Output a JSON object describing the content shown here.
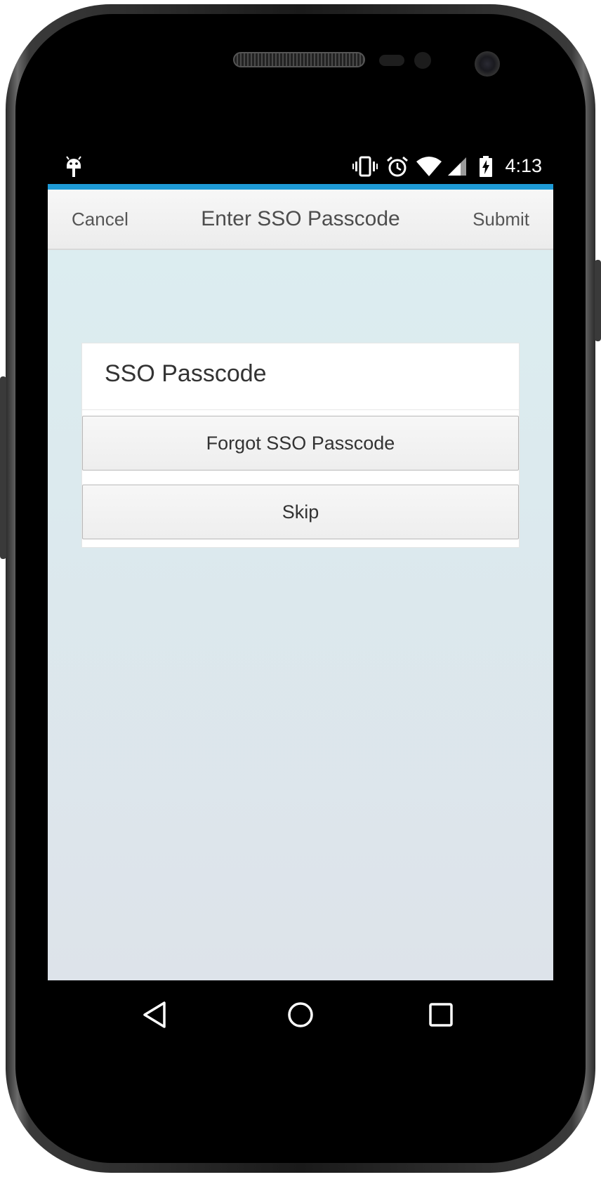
{
  "status_bar": {
    "time": "4:13",
    "icons": [
      "android-icon",
      "vibrate-icon",
      "alarm-icon",
      "wifi-icon",
      "signal-icon",
      "battery-charging-icon"
    ]
  },
  "nav_bar": {
    "left_label": "Cancel",
    "title": "Enter SSO Passcode",
    "right_label": "Submit"
  },
  "card": {
    "title": "SSO Passcode",
    "buttons": {
      "forgot_label": "Forgot SSO Passcode",
      "skip_label": "Skip"
    }
  },
  "system_nav": {
    "icons": [
      "back-icon",
      "home-icon",
      "recents-icon"
    ]
  },
  "colors": {
    "accent": "#1e9ad6",
    "background_top": "#dcedf0",
    "background_bottom": "#dde3ea"
  }
}
